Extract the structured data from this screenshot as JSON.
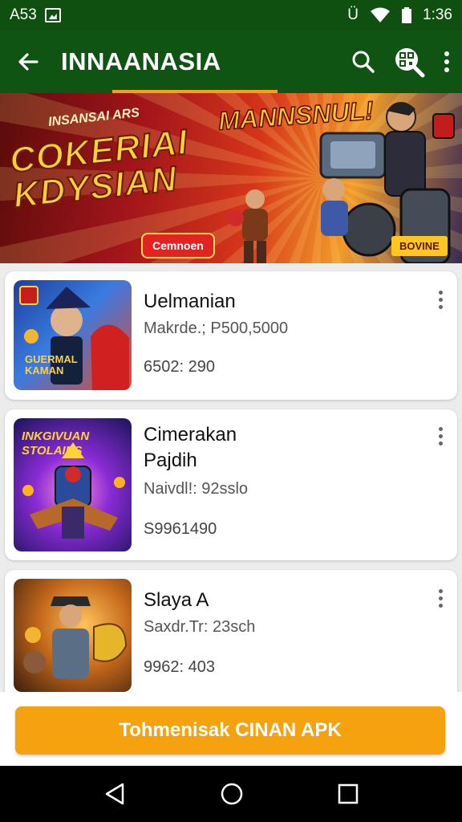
{
  "status_bar": {
    "left_text": "A53",
    "time": "1:36",
    "signal_glyph": "Ü"
  },
  "app_bar": {
    "title": "INNAANASIA"
  },
  "banner": {
    "promo_small": "INSANSAI ARS",
    "promo_main": "COKERIAI KDYSIAN",
    "headline": "MANNSNUL!",
    "cta_left": "Cemnoen",
    "cta_right": "BOVINE"
  },
  "apps": [
    {
      "name": "Uelmanian",
      "desc": "Makrde.; P500,5000",
      "count": "6502: 290",
      "thumb_text": "GUERMAL KAMAN"
    },
    {
      "name": "Cimerakan Pajdih",
      "desc": "Naivdl!: 92sslo",
      "count": "S9961490",
      "thumb_text": "INKGIVUAN STOLAINS"
    },
    {
      "name": "Slaya A",
      "desc": "Saxdr.Tr: 23sch",
      "count": "9962: 403",
      "thumb_text": ""
    }
  ],
  "install_button": "Tohmenisak CINAN APK",
  "colors": {
    "app_bar": "#0f5412",
    "accent": "#f5a20e"
  }
}
